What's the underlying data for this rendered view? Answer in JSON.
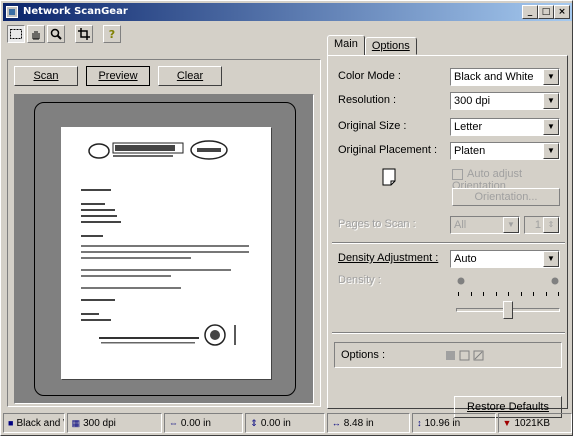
{
  "window": {
    "title": "Network ScanGear"
  },
  "toolbar": {
    "tools": [
      "marquee-tool",
      "hand-tool",
      "zoom-tool",
      "crop-tool",
      "help-tool"
    ]
  },
  "buttons": {
    "scan": "Scan",
    "preview": "Preview",
    "clear": "Clear"
  },
  "tabs": {
    "main": "Main",
    "options": "Options"
  },
  "settings": {
    "color_mode": {
      "label": "Color Mode :",
      "value": "Black and White"
    },
    "resolution": {
      "label": "Resolution :",
      "value": "300 dpi"
    },
    "original_size": {
      "label": "Original Size :",
      "value": "Letter"
    },
    "original_placement": {
      "label": "Original Placement :",
      "value": "Platen"
    },
    "auto_adjust_orientation": "Auto adjust Orientation",
    "orientation_button": "Orientation...",
    "pages_to_scan": {
      "label": "Pages to Scan :",
      "value": "All",
      "count": "1"
    },
    "density_adjustment": {
      "label": "Density Adjustment :",
      "value": "Auto"
    },
    "density": {
      "label": "Density :",
      "level": 0.5
    },
    "options_label": "Options :",
    "restore_defaults": "Restore Defaults"
  },
  "status": {
    "mode": "Black and Wh",
    "dpi": "300 dpi",
    "x": "0.00 in",
    "y": "0.00 in",
    "width": "8.48 in",
    "height": "10.96 in",
    "size": "1021KB"
  }
}
